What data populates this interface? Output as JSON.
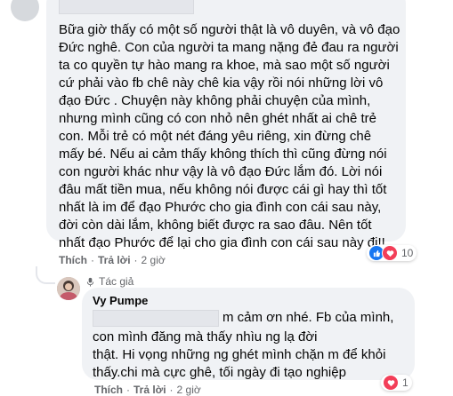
{
  "comment1": {
    "text": "Bữa giờ thấy có một số người thật là vô duyên, và vô đạo\nĐức nghê. Con của người ta mang nặng đẻ đau ra người\nta co quyền tự hào mang ra khoe, mà sao một số người\ncứ phải vào fb chê này chê kia vậy rồi nói những lời vô\nđạo Đức . Chuyện này không phải chuyện của mình,\nnhưng mình cũng có con nhỏ nên ghét nhất ai chê trẻ\ncon. Mỗi trẻ có một nét đáng yêu riêng, xin đừng chê\nmấy bé. Nếu ai cảm thấy không thích thì cũng đừng nói\ncon người khác như vậy là vô đạo Đức lắm đó. Lời nói\nđâu mất tiền mua, nếu không nói được cái gì hay thì tốt\nnhất là im để đạo Phước cho gia đình con cái sau này,\nđời còn dài lắm, không biết được ra sao đâu. Nên tốt\nnhất đạo Phước để lại cho gia đình con cái sau này đi!!",
    "actions": {
      "like": "Thích",
      "reply": "Trả lời",
      "time": "2 giờ"
    },
    "reactions": {
      "count": "10",
      "icons": [
        "like-icon",
        "love-icon"
      ]
    },
    "colors": {
      "like": "#1877f2",
      "love": "#f33e58"
    }
  },
  "reply1": {
    "badge": "Tác giả",
    "author": "Vy Pumpe",
    "text_line1_after_redact": "m cảm ơn nhé. Fb của mình,",
    "text_rest": "con mình đăng mà thấy nhìu ng lạ đời\nthật. Hi vọng những ng ghét mình chặn m để khỏi\nthấy.chi mà cực ghê, tối ngày đi tạo nghiệp",
    "actions": {
      "like": "Thích",
      "reply": "Trả lời",
      "time": "2 giờ"
    },
    "reactions": {
      "count": "1",
      "icons": [
        "love-icon"
      ]
    }
  }
}
